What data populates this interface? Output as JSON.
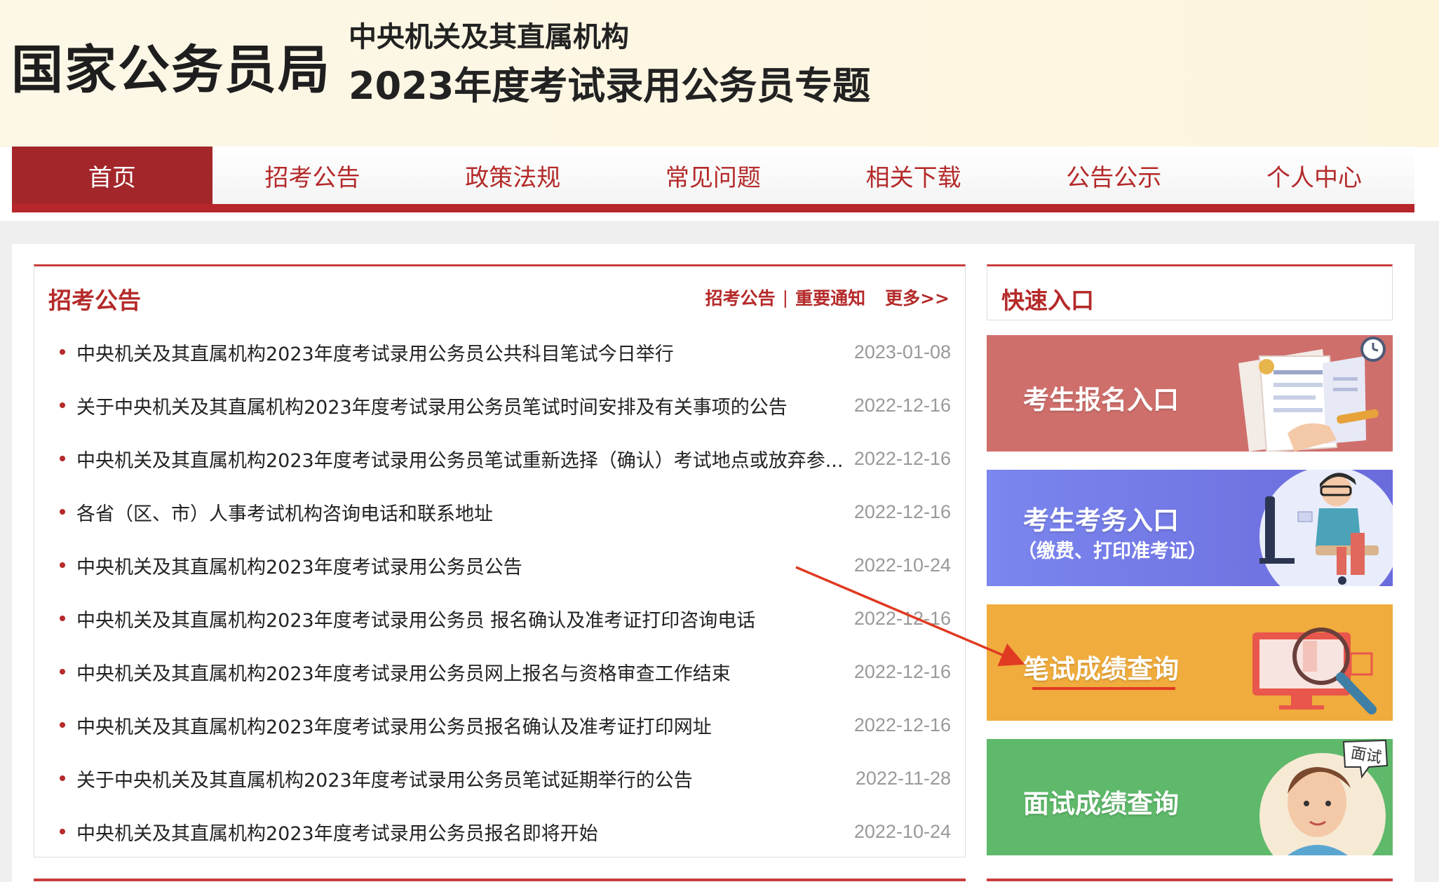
{
  "header": {
    "brand": "国家公务员局",
    "subtitle_line1": "中央机关及其直属机构",
    "subtitle_line2": "2023年度考试录用公务员专题"
  },
  "nav": {
    "items": [
      {
        "label": "首页",
        "active": true
      },
      {
        "label": "招考公告"
      },
      {
        "label": "政策法规"
      },
      {
        "label": "常见问题"
      },
      {
        "label": "相关下载"
      },
      {
        "label": "公告公示"
      },
      {
        "label": "个人中心"
      }
    ]
  },
  "notices": {
    "title": "招考公告",
    "link1": "招考公告",
    "separator": "|",
    "link2": "重要通知",
    "more": "更多>>",
    "items": [
      {
        "title": "中央机关及其直属机构2023年度考试录用公务员公共科目笔试今日举行",
        "date": "2023-01-08"
      },
      {
        "title": "关于中央机关及其直属机构2023年度考试录用公务员笔试时间安排及有关事项的公告",
        "date": "2022-12-16"
      },
      {
        "title": "中央机关及其直属机构2023年度考试录用公务员笔试重新选择（确认）考试地点或放弃参...",
        "date": "2022-12-16"
      },
      {
        "title": "各省（区、市）人事考试机构咨询电话和联系地址",
        "date": "2022-12-16"
      },
      {
        "title": "中央机关及其直属机构2023年度考试录用公务员公告",
        "date": "2022-10-24"
      },
      {
        "title": "中央机关及其直属机构2023年度考试录用公务员 报名确认及准考证打印咨询电话",
        "date": "2022-12-16"
      },
      {
        "title": "中央机关及其直属机构2023年度考试录用公务员网上报名与资格审查工作结束",
        "date": "2022-12-16"
      },
      {
        "title": "中央机关及其直属机构2023年度考试录用公务员报名确认及准考证打印网址",
        "date": "2022-12-16"
      },
      {
        "title": "关于中央机关及其直属机构2023年度考试录用公务员笔试延期举行的公告",
        "date": "2022-11-28"
      },
      {
        "title": "中央机关及其直属机构2023年度考试录用公务员报名即将开始",
        "date": "2022-10-24"
      }
    ]
  },
  "quick": {
    "title": "快速入口",
    "tiles": [
      {
        "label": "考生报名入口",
        "icon": "application-form-icon"
      },
      {
        "label": "考生考务入口",
        "sub": "（缴费、打印准考证）",
        "icon": "person-at-computer-icon"
      },
      {
        "label": "笔试成绩查询",
        "icon": "magnifier-screen-icon"
      },
      {
        "label": "面试成绩查询",
        "bubble": "面试",
        "icon": "interviewee-avatar-icon"
      }
    ]
  },
  "colors": {
    "brand_red": "#a3262a",
    "tile1": "#cf6f6c",
    "tile2": "#7078e6",
    "tile3": "#f0ac3c",
    "tile4": "#5fb96b",
    "annotation_arrow": "#e03a22"
  }
}
